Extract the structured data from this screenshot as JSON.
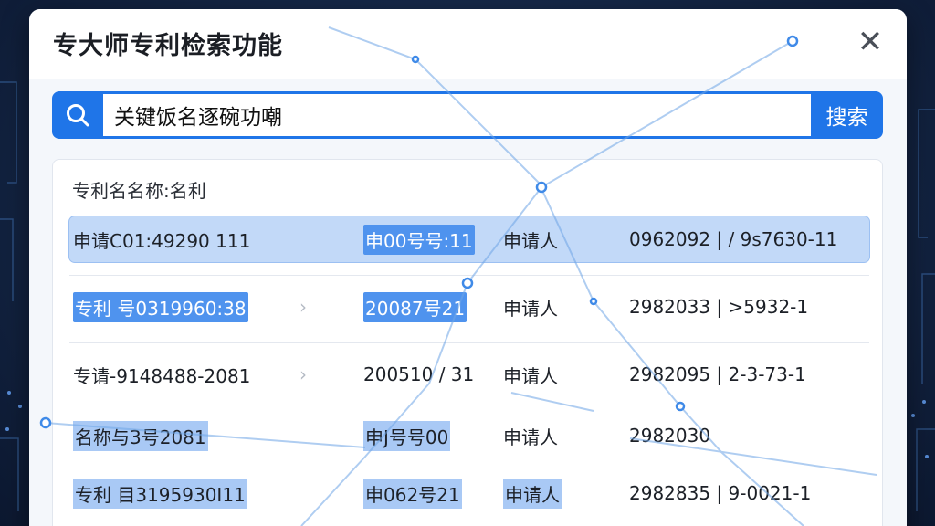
{
  "dialog": {
    "title": "专大师专利检索功能",
    "close_glyph": "✕"
  },
  "search": {
    "value": "关键饭名逐碗功嘲",
    "button_label": "搜索"
  },
  "results": {
    "header": "专利名名称:名利",
    "rows": [
      {
        "c1": "申请C01:49290 111",
        "c2": "申00号号:11",
        "c3": "申请人",
        "c4": "0962092 | / 9s7630-11"
      },
      {
        "c1": "专利 号0319960:38",
        "c2": "20087号21",
        "c3": "申请人",
        "c4": "2982033 | >5932-1"
      },
      {
        "c1": "专请-9148488-2081",
        "c2": "200510 / 31",
        "c3": "申请人",
        "c4": "2982095 | 2-3-73-1"
      },
      {
        "c1": "名称与3号2081",
        "c2": "申J号号00",
        "c3": "申请人",
        "c4": "2982030"
      },
      {
        "c1": "专利 目3195930I11",
        "c2": "申062号21",
        "c3": "申请人",
        "c4": "2982835 | 9-0021-1"
      }
    ]
  },
  "icons": {
    "search": "search-icon",
    "close": "close-icon",
    "chevron": "chevron-right-icon"
  },
  "colors": {
    "accent": "#1f75e8",
    "selected_row": "#c2d9f8",
    "highlight": "#4f93ee",
    "background": "#16294a"
  }
}
